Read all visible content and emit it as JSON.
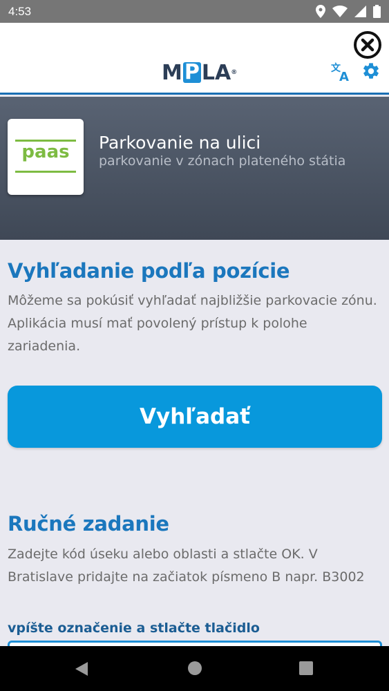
{
  "status_bar": {
    "time": "4:53",
    "icons": [
      "location-icon",
      "wifi-icon",
      "signal-icon",
      "battery-icon"
    ]
  },
  "header": {
    "logo": {
      "left": "M",
      "mid": "P",
      "right": "LA",
      "reg": "®"
    },
    "icons": [
      "close-icon",
      "translate-icon",
      "gear-icon"
    ]
  },
  "hero": {
    "tile_text": "paas",
    "title": "Parkovanie na ulici",
    "subtitle": "parkovanie v zónach plateného státia"
  },
  "location_section": {
    "title": "Vyhľadanie podľa pozície",
    "text": "Môžeme sa pokúsiť vyhľadať najbližšie parkovacie zónu. Aplikácia musí mať povolený prístup k polohe zariadenia.",
    "button_label": "Vyhľadať"
  },
  "manual_section": {
    "title": "Ručné zadanie",
    "text": "Zadejte kód úseku alebo oblasti a stlačte OK. V Bratislave pridajte na začiatok písmeno B napr. B3002",
    "input_label": "vpíšte označenie a stlačte tlačidlo",
    "input_value": ""
  },
  "nav_bar": {
    "icons": [
      "back-icon",
      "home-icon",
      "recent-apps-icon"
    ]
  },
  "colors": {
    "accent": "#0898dc",
    "title_blue": "#1b77bd",
    "paas_green": "#7dbb42",
    "hero_dark": "#3f4856"
  }
}
